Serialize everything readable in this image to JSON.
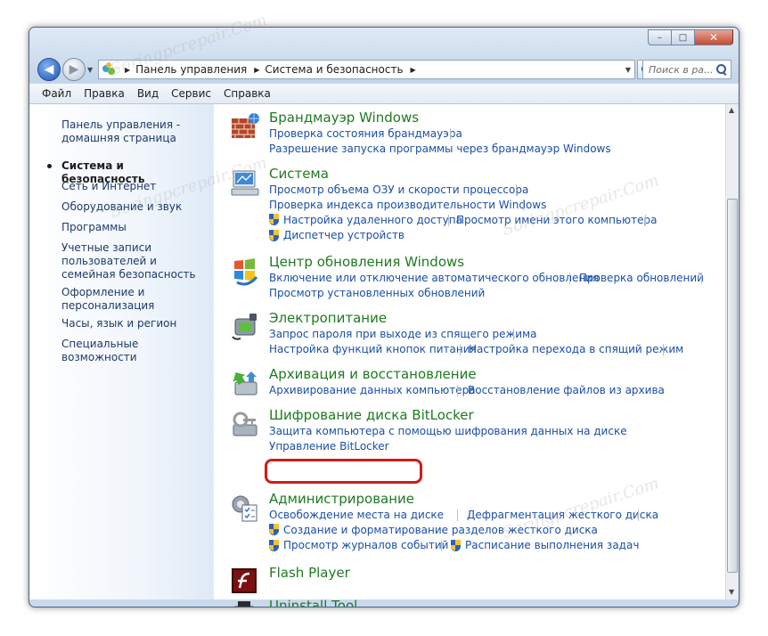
{
  "window": {
    "caption_buttons": {
      "minimize": "–",
      "maximize": "□",
      "close": "✕"
    },
    "nav": {
      "back": "◀",
      "forward": "▶"
    },
    "breadcrumb": [
      "Панель управления",
      "Система и безопасность"
    ],
    "search_placeholder": "Поиск в ра..."
  },
  "menu": [
    "Файл",
    "Правка",
    "Вид",
    "Сервис",
    "Справка"
  ],
  "sidebar": {
    "home": "Панель управления - домашняя страница",
    "items": [
      {
        "label": "Система и безопасность",
        "active": true
      },
      {
        "label": "Сеть и Интернет"
      },
      {
        "label": "Оборудование и звук"
      },
      {
        "label": "Программы"
      },
      {
        "label": "Учетные записи пользователей и семейная безопасность"
      },
      {
        "label": "Оформление и персонализация"
      },
      {
        "label": "Часы, язык и регион"
      },
      {
        "label": "Специальные возможности"
      }
    ]
  },
  "categories": [
    {
      "title": "Брандмауэр Windows",
      "icon": "firewall-icon",
      "links": [
        [
          "Проверка состояния брандмауэра"
        ],
        [
          "Разрешение запуска программы через брандмауэр Windows"
        ]
      ]
    },
    {
      "title": "Система",
      "icon": "system-icon",
      "links": [
        [
          "Просмотр объема ОЗУ и скорости процессора"
        ],
        [
          "Проверка индекса производительности Windows"
        ],
        [
          "Настройка удаленного доступа",
          "Просмотр имени этого компьютера"
        ],
        [
          "Диспетчер устройств"
        ]
      ]
    },
    {
      "title": "Центр обновления Windows",
      "icon": "windows-update-icon",
      "links": [
        [
          "Включение или отключение автоматического обновления",
          "Проверка обновлений"
        ],
        [
          "Просмотр установленных обновлений"
        ]
      ]
    },
    {
      "title": "Электропитание",
      "icon": "power-options-icon",
      "links": [
        [
          "Запрос пароля при выходе из спящего режима"
        ],
        [
          "Настройка функций кнопок питания",
          "Настройка перехода в спящий режим"
        ]
      ]
    },
    {
      "title": "Архивация и восстановление",
      "icon": "backup-restore-icon",
      "links": [
        [
          "Архивирование данных компьютера",
          "Восстановление файлов из архива"
        ]
      ]
    },
    {
      "title": "Шифрование диска BitLocker",
      "icon": "bitlocker-icon",
      "links": [
        [
          "Защита компьютера с помощью шифрования данных на диске"
        ],
        [
          "Управление BitLocker"
        ]
      ]
    },
    {
      "title": "Администрирование",
      "icon": "administrative-tools-icon",
      "links": [
        [
          "Освобождение места на диске",
          "Дефрагментация жесткого диска"
        ],
        [
          "Создание и форматирование разделов жесткого диска"
        ],
        [
          "Просмотр журналов событий",
          "Расписание выполнения задач"
        ]
      ]
    },
    {
      "title": "Flash Player",
      "icon": "flash-player-icon",
      "links": []
    },
    {
      "title": "Uninstall Tool",
      "icon": "uninstall-tool-icon",
      "links": []
    }
  ],
  "watermark": "Soringpcrepair.Com"
}
